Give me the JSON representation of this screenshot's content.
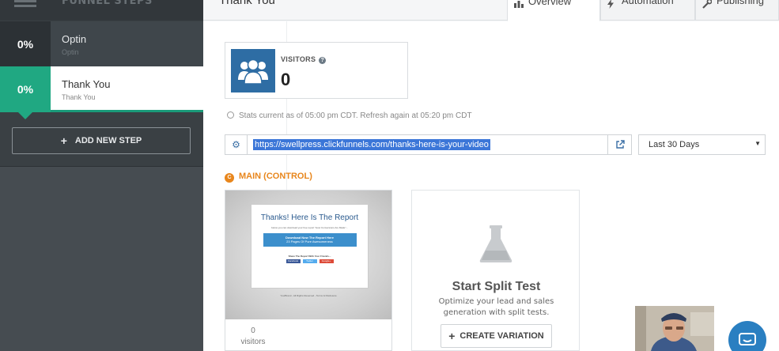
{
  "sidebar": {
    "title": "FUNNEL STEPS",
    "steps": [
      {
        "percent": "0%",
        "name": "Optin",
        "subtitle": "Optin"
      },
      {
        "percent": "0%",
        "name": "Thank You",
        "subtitle": "Thank You"
      }
    ],
    "add_step_label": "ADD NEW STEP"
  },
  "header": {
    "page_title": "Thank You",
    "tabs": [
      {
        "label": "Overview",
        "icon": "chart-icon",
        "active": true
      },
      {
        "label": "Automation",
        "icon": "bolt-icon",
        "active": false
      },
      {
        "label": "Publishing",
        "icon": "wrench-icon",
        "active": false
      }
    ]
  },
  "visitors": {
    "label": "VISITORS",
    "count": "0"
  },
  "stats_text": "Stats current as of 05:00 pm CDT. Refresh again at 05:20 pm CDT",
  "url_bar": {
    "url": "https://swellpress.clickfunnels.com/thanks-here-is-your-video"
  },
  "date_range": {
    "selected": "Last 30 Days"
  },
  "variant": {
    "badge": "C",
    "label": "MAIN (CONTROL)",
    "visitors_count": "0",
    "visitors_label": "visitors",
    "preview": {
      "title": "Thanks! Here Is The Report",
      "subtitle": "below you can download your free report \"How Conversions Are Made\"...",
      "button": "Download Now The Report Here",
      "button_sub": "23 Pages Of Pure Awesomeness",
      "share": "Share The Report With Your Friends...",
      "share_buttons": [
        "Facebook",
        "Twitter",
        "Google+"
      ],
      "footer": "YourBrand - All Rights Reserved - Terms & Disclosure"
    }
  },
  "split_test": {
    "title": "Start Split Test",
    "description": "Optimize your lead and sales generation with split tests.",
    "button_label": "CREATE VARIATION"
  },
  "colors": {
    "sidebar_bg": "#3a4044",
    "active_step": "#20a882",
    "accent_blue": "#2e6da4",
    "control_orange": "#e8861c",
    "chat_blue": "#2a7fc1"
  }
}
